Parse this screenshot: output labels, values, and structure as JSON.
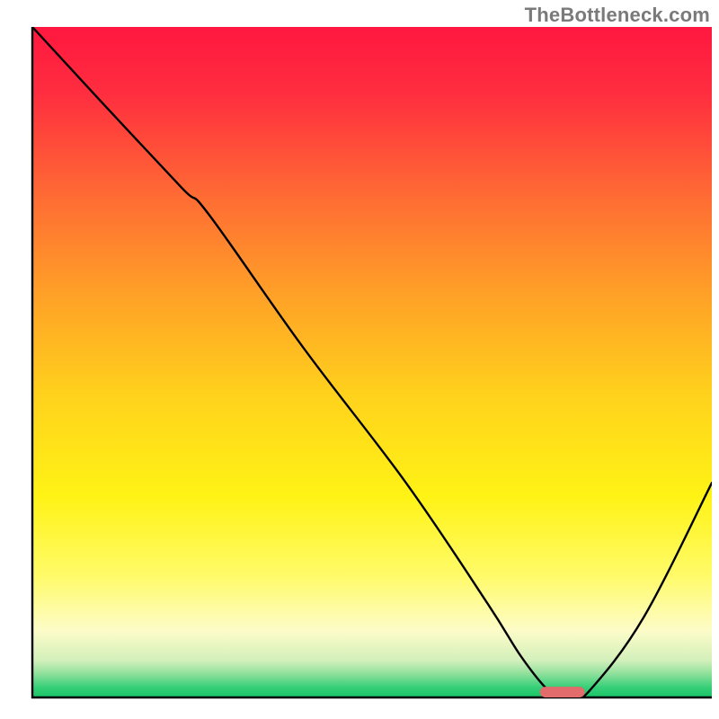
{
  "attribution": "TheBottleneck.com",
  "chart_data": {
    "type": "line",
    "title": "",
    "xlabel": "",
    "ylabel": "",
    "xlim": [
      0,
      100
    ],
    "ylim": [
      0,
      100
    ],
    "legend": false,
    "grid": false,
    "gradient_bands": [
      {
        "stop": 0.0,
        "color": "#ff173f"
      },
      {
        "stop": 0.1,
        "color": "#ff2e3f"
      },
      {
        "stop": 0.25,
        "color": "#ff6a34"
      },
      {
        "stop": 0.4,
        "color": "#ffa127"
      },
      {
        "stop": 0.55,
        "color": "#ffd21c"
      },
      {
        "stop": 0.7,
        "color": "#fff315"
      },
      {
        "stop": 0.82,
        "color": "#fffb6a"
      },
      {
        "stop": 0.9,
        "color": "#fdfcc8"
      },
      {
        "stop": 0.945,
        "color": "#d3f0bb"
      },
      {
        "stop": 0.965,
        "color": "#8ee09b"
      },
      {
        "stop": 0.985,
        "color": "#36cf78"
      },
      {
        "stop": 1.0,
        "color": "#18c566"
      }
    ],
    "series": [
      {
        "name": "bottleneck-curve",
        "color": "#000000",
        "width": 2.4,
        "x": [
          0,
          10,
          22,
          26,
          40,
          55,
          67,
          72,
          76,
          78,
          80,
          82,
          90,
          100
        ],
        "y": [
          100,
          89,
          76,
          72,
          52,
          32,
          14,
          6,
          1,
          0.5,
          0.5,
          1,
          12,
          32
        ]
      }
    ],
    "marker": {
      "name": "optimal-range",
      "shape": "pill",
      "color": "#e26b6b",
      "x_center": 78,
      "x_half_width": 3.3,
      "y": 0.8,
      "height_pct": 1.6
    },
    "axes": {
      "show_ticks": false,
      "frame_color": "#000000",
      "frame_width": 2.4
    }
  }
}
